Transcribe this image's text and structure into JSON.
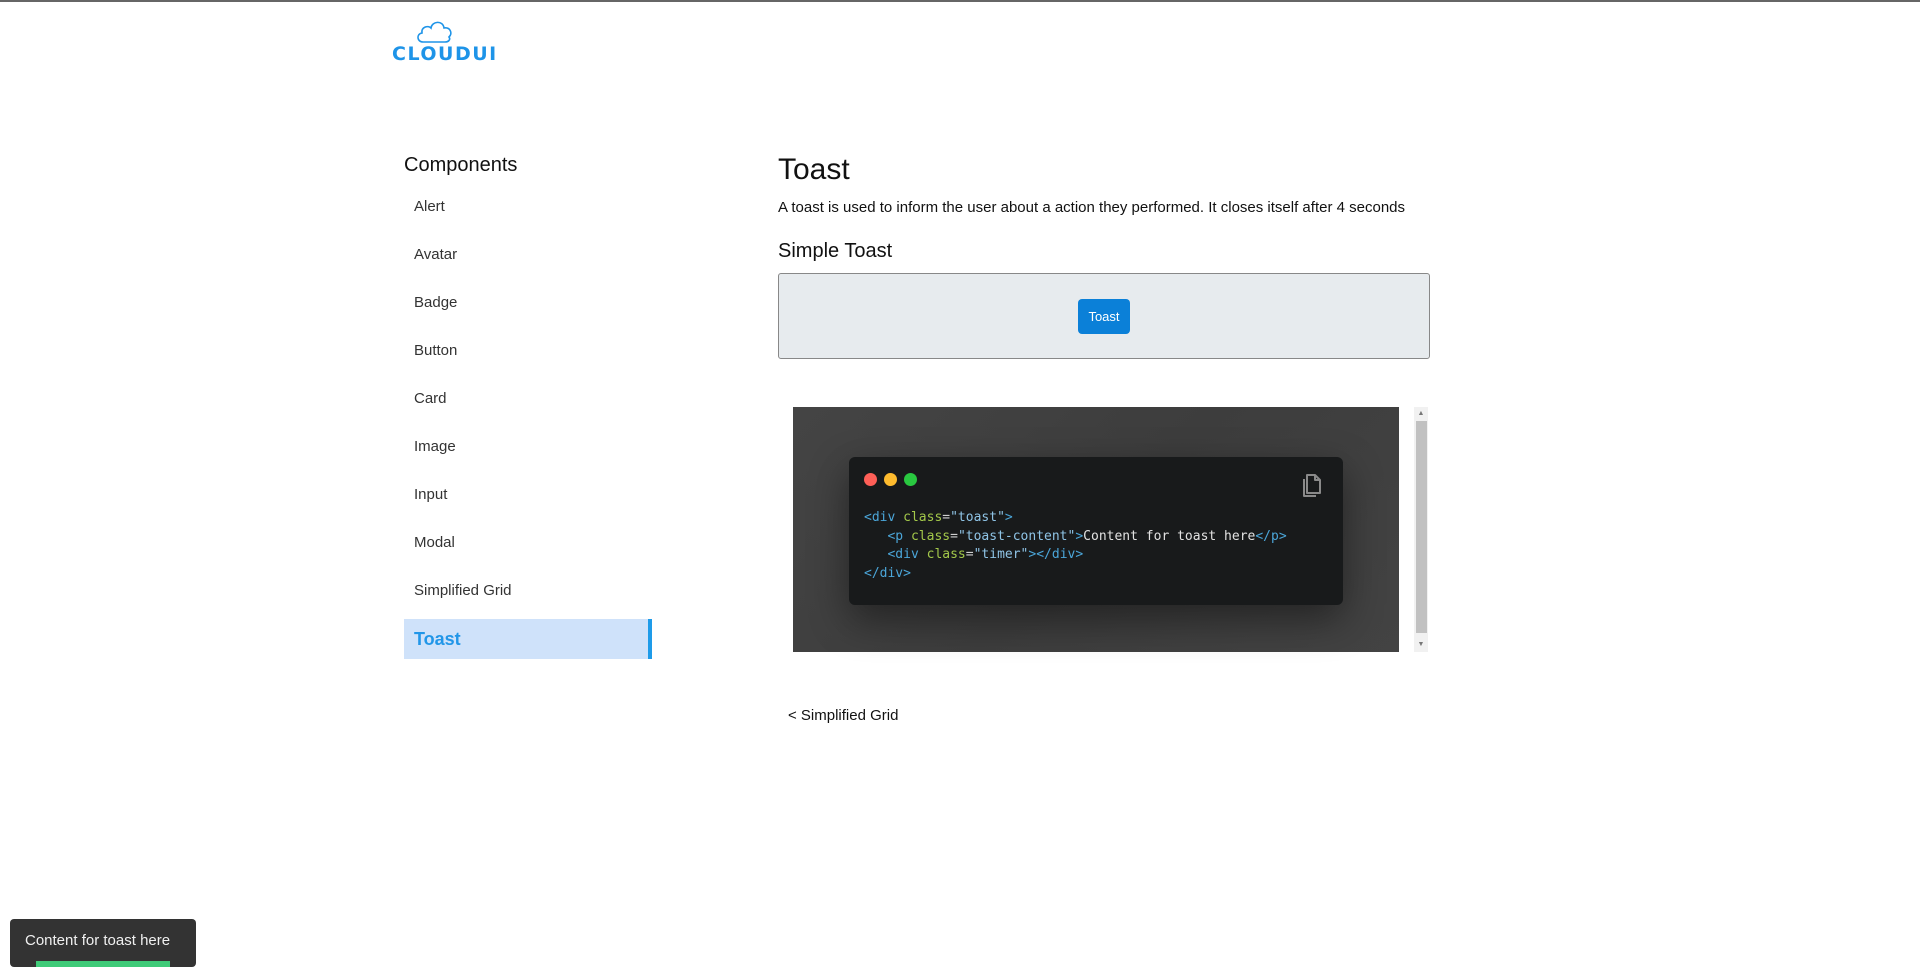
{
  "logo": {
    "text": "CLOUDUI",
    "icon": "cloud-icon",
    "color": "#1e94e8"
  },
  "sidebar": {
    "title": "Components",
    "items": [
      {
        "label": "Alert",
        "active": false
      },
      {
        "label": "Avatar",
        "active": false
      },
      {
        "label": "Badge",
        "active": false
      },
      {
        "label": "Button",
        "active": false
      },
      {
        "label": "Card",
        "active": false
      },
      {
        "label": "Image",
        "active": false
      },
      {
        "label": "Input",
        "active": false
      },
      {
        "label": "Modal",
        "active": false
      },
      {
        "label": "Simplified Grid",
        "active": false
      },
      {
        "label": "Toast",
        "active": true
      }
    ]
  },
  "main": {
    "title": "Toast",
    "description": "A toast is used to inform the user about a action they performed. It closes itself after 4 seconds",
    "section_title": "Simple Toast",
    "demo_button_label": "Toast",
    "code": {
      "window_dots": [
        "red",
        "yellow",
        "green"
      ],
      "copy_icon": "copy-icon",
      "lines": [
        {
          "indent": "",
          "open": "<div",
          "attr": "class",
          "eq": "=",
          "value": "\"toast\"",
          "close": ">",
          "text": "",
          "end": ""
        },
        {
          "indent": "   ",
          "open": "<p",
          "attr": "class",
          "eq": "=",
          "value": "\"toast-content\"",
          "close": ">",
          "text": "Content for toast here",
          "end": "</p>"
        },
        {
          "indent": "   ",
          "open": "<div",
          "attr": "class",
          "eq": "=",
          "value": "\"timer\"",
          "close": ">",
          "text": "",
          "end": "</div>"
        },
        {
          "indent": "",
          "open": "</div>",
          "attr": "",
          "eq": "",
          "value": "",
          "close": "",
          "text": "",
          "end": ""
        }
      ]
    },
    "back_link": "< Simplified Grid"
  },
  "toast": {
    "content": "Content for toast here",
    "timer_progress": 0.6,
    "timer_color": "#3fcb78"
  },
  "colors": {
    "accent": "#1e9be9",
    "active_bg": "#cfe2fa",
    "button_bg": "#0b80d8"
  }
}
